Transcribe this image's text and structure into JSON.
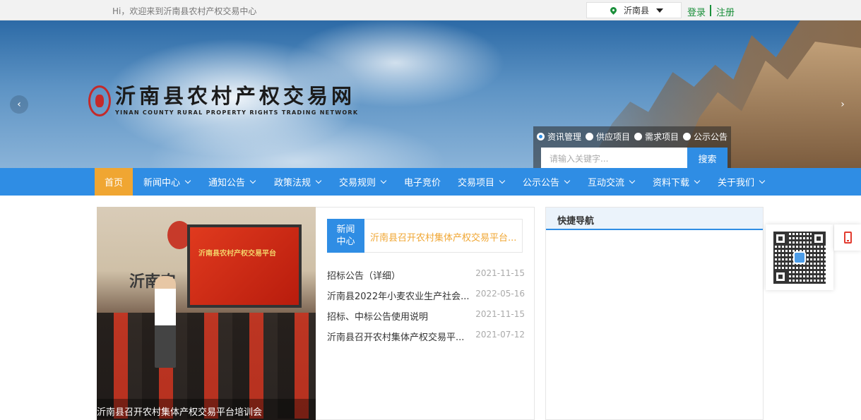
{
  "topbar": {
    "welcome": "Hi，欢迎来到沂南县农村产权交易中心",
    "region": "沂南县",
    "login": "登录",
    "register": "注册"
  },
  "banner": {
    "title": "沂南县农村产权交易网",
    "subtitle": "YINAN COUNTY RURAL PROPERTY RIGHTS TRADING NETWORK",
    "search": {
      "options": [
        "资讯管理",
        "供应项目",
        "需求项目",
        "公示公告"
      ],
      "selected": "资讯管理",
      "placeholder": "请输入关键字...",
      "button": "搜索"
    }
  },
  "nav": {
    "items": [
      {
        "label": "首页"
      },
      {
        "label": "新闻中心"
      },
      {
        "label": "通知公告"
      },
      {
        "label": "政策法规"
      },
      {
        "label": "交易规则"
      },
      {
        "label": "电子竞价"
      },
      {
        "label": "交易项目"
      },
      {
        "label": "公示公告"
      },
      {
        "label": "互动交流"
      },
      {
        "label": "资料下载"
      },
      {
        "label": "关于我们"
      }
    ]
  },
  "slide": {
    "caption": "沂南县召开农村集体产权交易平台培训会",
    "wall_text": "沂南农",
    "screen_text": "沂南县农村产权交易平台"
  },
  "news": {
    "tab": "新闻中心",
    "headline": "沂南县召开农村集体产权交易平台...",
    "items": [
      {
        "title": "招标公告（详细）",
        "date": "2021-11-15"
      },
      {
        "title": "沂南县2022年小麦农业生产社会...",
        "date": "2022-05-16"
      },
      {
        "title": "招标、中标公告使用说明",
        "date": "2021-11-15"
      },
      {
        "title": "沂南县召开农村集体产权交易平...",
        "date": "2021-07-12"
      }
    ]
  },
  "quick_nav": {
    "title": "快捷导航"
  },
  "colors": {
    "primary": "#2f8de4",
    "accent": "#f0a632",
    "green": "#1a8f3a"
  }
}
